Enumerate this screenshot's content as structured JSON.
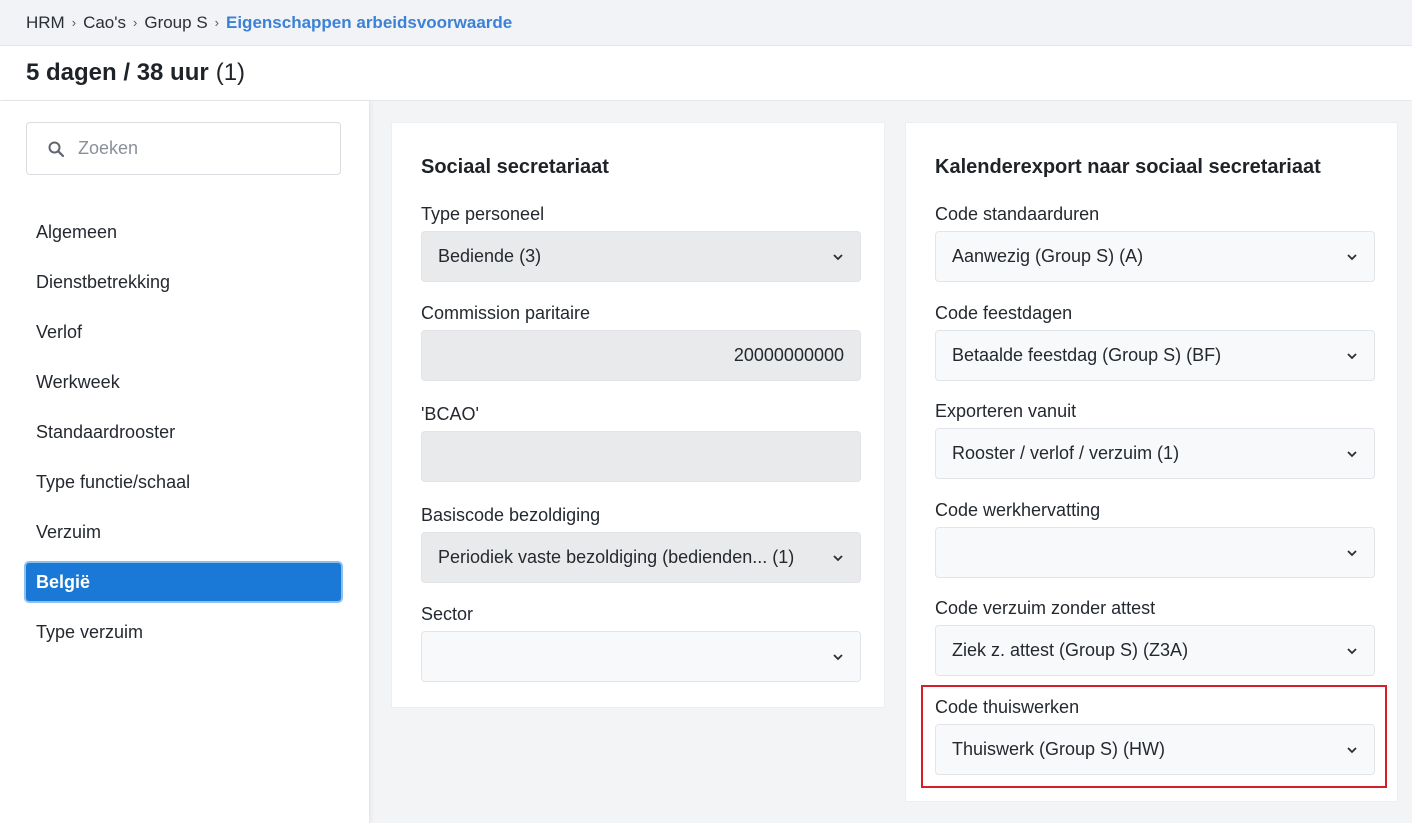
{
  "breadcrumb": {
    "items": [
      "HRM",
      "Cao's",
      "Group S"
    ],
    "current": "Eigenschappen arbeidsvoorwaarde"
  },
  "title": {
    "main": "5 dagen / 38 uur",
    "count": "(1)"
  },
  "search": {
    "placeholder": "Zoeken",
    "value": ""
  },
  "nav": {
    "items": [
      "Algemeen",
      "Dienstbetrekking",
      "Verlof",
      "Werkweek",
      "Standaardrooster",
      "Type functie/schaal",
      "Verzuim",
      "België",
      "Type verzuim"
    ],
    "active": "België"
  },
  "left_panel": {
    "title": "Sociaal secretariaat",
    "fields": [
      {
        "label": "Type personeel",
        "value": "Bediende (3)"
      },
      {
        "label": "Commission paritaire",
        "value": "20000000000"
      },
      {
        "label": "'BCAO'",
        "value": ""
      },
      {
        "label": "Basiscode bezoldiging",
        "value": "Periodiek vaste bezoldiging (bedienden... (1)"
      },
      {
        "label": "Sector",
        "value": ""
      }
    ]
  },
  "right_panel": {
    "title": "Kalenderexport naar sociaal secretariaat",
    "fields": [
      {
        "label": "Code standaarduren",
        "value": "Aanwezig (Group S) (A)"
      },
      {
        "label": "Code feestdagen",
        "value": "Betaalde feestdag (Group S) (BF)"
      },
      {
        "label": "Exporteren vanuit",
        "value": "Rooster / verlof / verzuim (1)"
      },
      {
        "label": "Code werkhervatting",
        "value": ""
      },
      {
        "label": "Code verzuim zonder attest",
        "value": "Ziek z. attest (Group S) (Z3A)"
      },
      {
        "label": "Code thuiswerken",
        "value": "Thuiswerk (Group S) (HW)"
      }
    ]
  },
  "colors": {
    "accent": "#1a79d6",
    "breadcrumb_current": "#3b82d6",
    "highlight": "#d3202a"
  }
}
